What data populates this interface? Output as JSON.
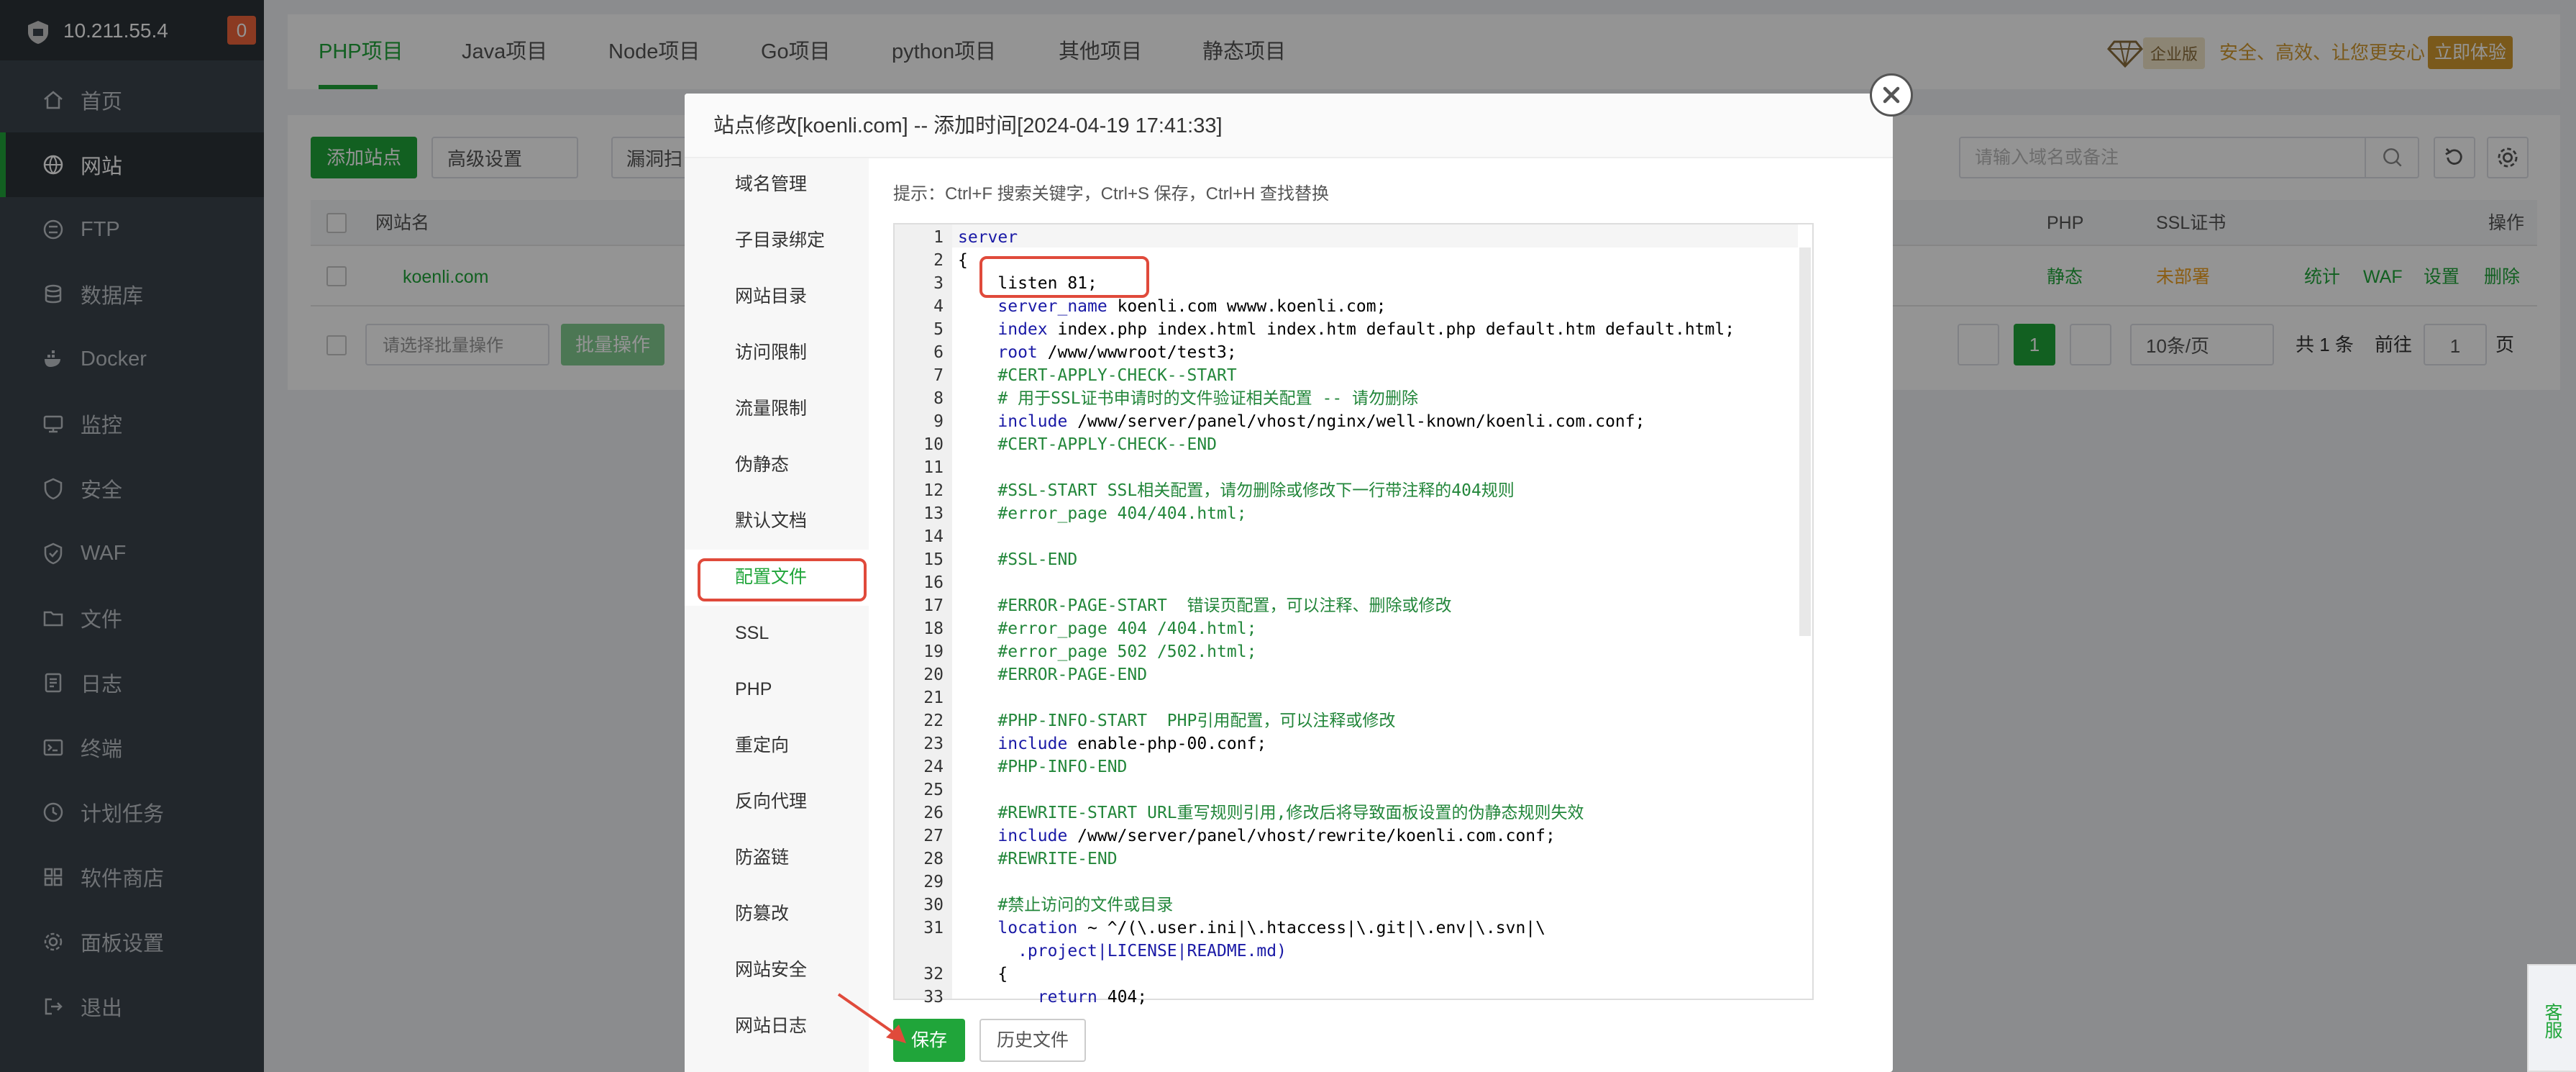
{
  "sidebar": {
    "ip": "10.211.55.4",
    "badge": "0",
    "items": [
      {
        "label": "首页"
      },
      {
        "label": "网站"
      },
      {
        "label": "FTP"
      },
      {
        "label": "数据库"
      },
      {
        "label": "Docker"
      },
      {
        "label": "监控"
      },
      {
        "label": "安全"
      },
      {
        "label": "WAF"
      },
      {
        "label": "文件"
      },
      {
        "label": "日志"
      },
      {
        "label": "终端"
      },
      {
        "label": "计划任务"
      },
      {
        "label": "软件商店"
      },
      {
        "label": "面板设置"
      },
      {
        "label": "退出"
      }
    ]
  },
  "tabs": [
    "PHP项目",
    "Java项目",
    "Node项目",
    "Go项目",
    "python项目",
    "其他项目",
    "静态项目"
  ],
  "enterprise": {
    "label": "企业版",
    "slogan": "安全、高效、让您更安心",
    "trial": "立即体验"
  },
  "toolbar": {
    "add_site": "添加站点",
    "advanced": "高级设置",
    "scan": "漏洞扫",
    "search_placeholder": "请输入域名或备注"
  },
  "table": {
    "headers": {
      "name": "网站名",
      "php": "PHP",
      "ssl": "SSL证书",
      "ops": "操作"
    },
    "rows": [
      {
        "name": "koenli.com",
        "php": "静态",
        "ssl": "未部署",
        "ops": [
          "统计",
          "WAF",
          "设置",
          "删除"
        ]
      }
    ],
    "batch_select": "请选择批量操作",
    "batch_btn": "批量操作",
    "page": "1",
    "page_size": "10条/页",
    "total": "共 1 条",
    "goto": "前往",
    "goto_page": "1",
    "page_unit": "页"
  },
  "dialog": {
    "title": "站点修改[koenli.com] -- 添加时间[2024-04-19 17:41:33]",
    "nav": [
      "域名管理",
      "子目录绑定",
      "网站目录",
      "访问限制",
      "流量限制",
      "伪静态",
      "默认文档",
      "配置文件",
      "SSL",
      "PHP",
      "重定向",
      "反向代理",
      "防盗链",
      "防篡改",
      "网站安全",
      "网站日志"
    ],
    "active_nav": "配置文件",
    "tip": "提示：Ctrl+F 搜索关键字，Ctrl+S 保存，Ctrl+H 查找替换",
    "save": "保存",
    "history": "历史文件"
  },
  "code_lines": [
    {
      "n": "1",
      "t": "server"
    },
    {
      "n": "2",
      "t": "{"
    },
    {
      "n": "3",
      "t": "    listen 81;"
    },
    {
      "n": "4",
      "t": "    server_name koenli.com wwww.koenli.com;"
    },
    {
      "n": "5",
      "t": "    index index.php index.html index.htm default.php default.htm default.html;"
    },
    {
      "n": "6",
      "t": "    root /www/wwwroot/test3;"
    },
    {
      "n": "7",
      "t": "    #CERT-APPLY-CHECK--START"
    },
    {
      "n": "8",
      "t": "    # 用于SSL证书申请时的文件验证相关配置 -- 请勿删除"
    },
    {
      "n": "9",
      "t": "    include /www/server/panel/vhost/nginx/well-known/koenli.com.conf;"
    },
    {
      "n": "10",
      "t": "    #CERT-APPLY-CHECK--END"
    },
    {
      "n": "11",
      "t": ""
    },
    {
      "n": "12",
      "t": "    #SSL-START SSL相关配置，请勿删除或修改下一行带注释的404规则"
    },
    {
      "n": "13",
      "t": "    #error_page 404/404.html;"
    },
    {
      "n": "14",
      "t": ""
    },
    {
      "n": "15",
      "t": "    #SSL-END"
    },
    {
      "n": "16",
      "t": ""
    },
    {
      "n": "17",
      "t": "    #ERROR-PAGE-START  错误页配置，可以注释、删除或修改"
    },
    {
      "n": "18",
      "t": "    #error_page 404 /404.html;"
    },
    {
      "n": "19",
      "t": "    #error_page 502 /502.html;"
    },
    {
      "n": "20",
      "t": "    #ERROR-PAGE-END"
    },
    {
      "n": "21",
      "t": ""
    },
    {
      "n": "22",
      "t": "    #PHP-INFO-START  PHP引用配置，可以注释或修改"
    },
    {
      "n": "23",
      "t": "    include enable-php-00.conf;"
    },
    {
      "n": "24",
      "t": "    #PHP-INFO-END"
    },
    {
      "n": "25",
      "t": ""
    },
    {
      "n": "26",
      "t": "    #REWRITE-START URL重写规则引用,修改后将导致面板设置的伪静态规则失效"
    },
    {
      "n": "27",
      "t": "    include /www/server/panel/vhost/rewrite/koenli.com.conf;"
    },
    {
      "n": "28",
      "t": "    #REWRITE-END"
    },
    {
      "n": "29",
      "t": ""
    },
    {
      "n": "30",
      "t": "    #禁止访问的文件或目录"
    },
    {
      "n": "31",
      "t": "    location ~ ^/(\\.user.ini|\\.htaccess|\\.git|\\.env|\\.svn|\\"
    },
    {
      "n": "",
      "t": "      .project|LICENSE|README.md)"
    },
    {
      "n": "32",
      "t": "    {"
    },
    {
      "n": "33",
      "t": "        return 404;"
    }
  ],
  "floating": {
    "service": "客服"
  },
  "colors": {
    "brand": "#20a53a",
    "sidebar": "#3c444d",
    "highlight": "#e04a3b",
    "warning": "#f0a020"
  }
}
